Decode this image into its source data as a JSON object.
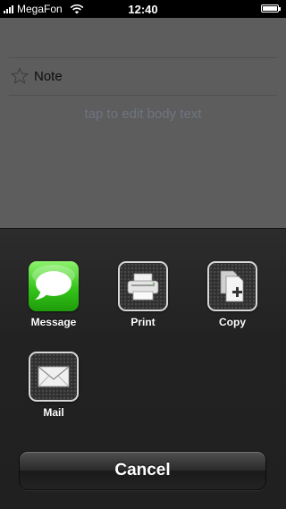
{
  "status_bar": {
    "carrier": "MegaFon",
    "time": "12:40",
    "battery_level": 1.0
  },
  "note": {
    "title": "Note",
    "body_placeholder": "tap to edit body text",
    "star_icon": "star-outline-icon"
  },
  "action_sheet": {
    "items": [
      {
        "label": "Message",
        "icon": "message-bubble-icon"
      },
      {
        "label": "Print",
        "icon": "printer-icon"
      },
      {
        "label": "Copy",
        "icon": "copy-document-icon"
      },
      {
        "label": "Mail",
        "icon": "envelope-icon"
      }
    ],
    "cancel_label": "Cancel"
  },
  "colors": {
    "status_bar_bg": "#000000",
    "dimmed_background": "#5d5d5d",
    "sheet_bg": "#252525",
    "message_green": "#35c51a"
  }
}
